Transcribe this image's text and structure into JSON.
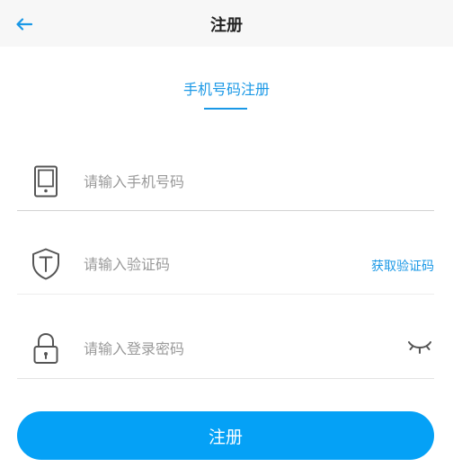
{
  "header": {
    "title": "注册",
    "back_icon": "arrow-left-icon"
  },
  "tab": {
    "label": "手机号码注册"
  },
  "phone": {
    "icon": "phone-icon",
    "placeholder": "请输入手机号码",
    "value": ""
  },
  "code": {
    "icon": "shield-icon",
    "placeholder": "请输入验证码",
    "value": "",
    "get_code_label": "获取验证码"
  },
  "password": {
    "icon": "lock-icon",
    "placeholder": "请输入登录密码",
    "value": "",
    "toggle_icon": "eye-closed-icon"
  },
  "submit": {
    "label": "注册"
  },
  "colors": {
    "accent": "#1a98e6",
    "button": "#05a1f6",
    "header_bg": "#f7f7f7",
    "placeholder": "#9a9a9a"
  }
}
